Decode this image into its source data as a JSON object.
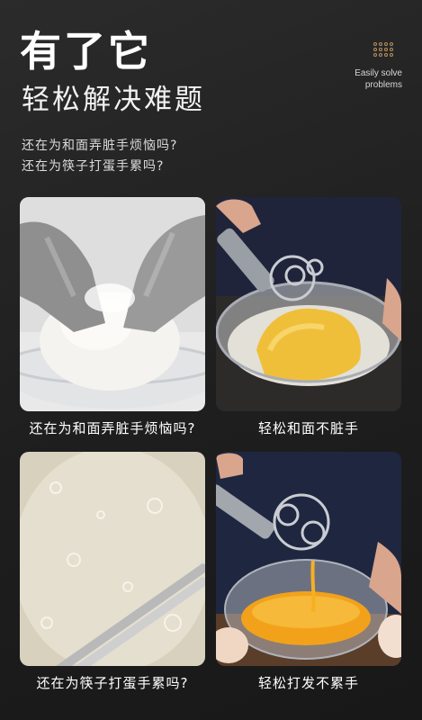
{
  "headline": "有了它",
  "subheadline": "轻松解决难题",
  "brand": {
    "icon": "dot-grid-icon",
    "text_line1": "Easily solve",
    "text_line2": "problems",
    "accent_color": "#b8905a"
  },
  "questions": [
    "还在为和面弄脏手烦恼吗?",
    "还在为筷子打蛋手累吗?"
  ],
  "panels": [
    {
      "caption": "还在为和面弄脏手烦恼吗?"
    },
    {
      "caption": "轻松和面不脏手"
    },
    {
      "caption": "还在为筷子打蛋手累吗?"
    },
    {
      "caption": "轻松打发不累手"
    }
  ]
}
